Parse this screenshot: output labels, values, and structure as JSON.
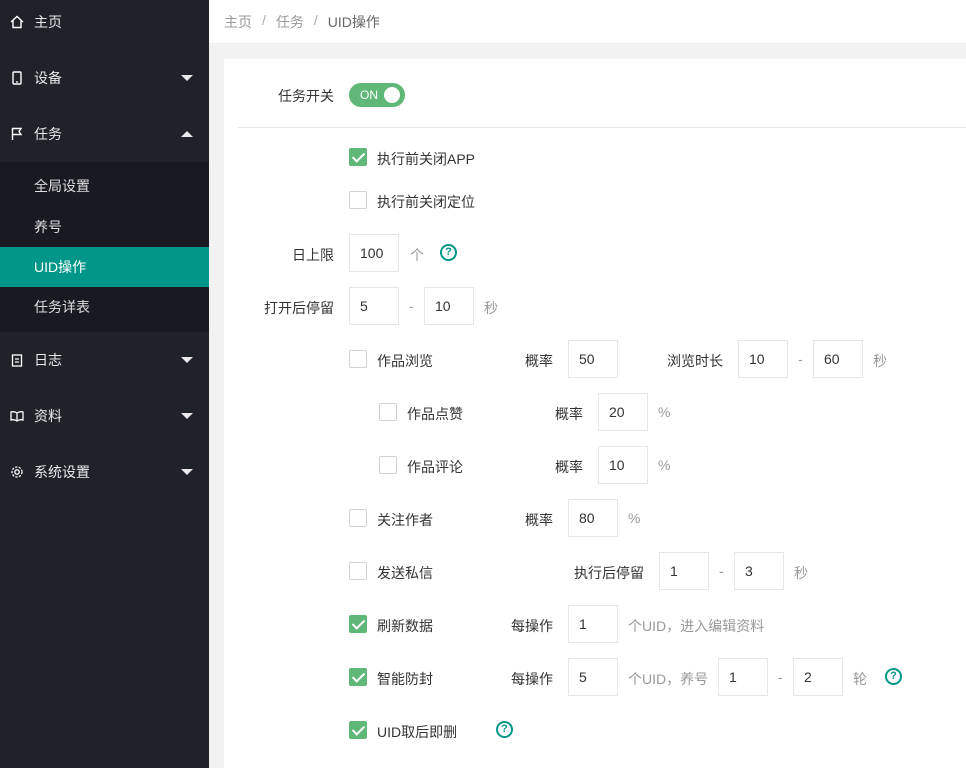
{
  "sidebar": {
    "items": [
      {
        "label": "主页",
        "icon": "home-icon"
      },
      {
        "label": "设备",
        "icon": "phone-icon"
      },
      {
        "label": "任务",
        "icon": "flag-icon"
      },
      {
        "label": "日志",
        "icon": "clipboard-icon"
      },
      {
        "label": "资料",
        "icon": "book-icon"
      },
      {
        "label": "系统设置",
        "icon": "gear-icon"
      }
    ],
    "sub_items": [
      {
        "label": "全局设置"
      },
      {
        "label": "养号"
      },
      {
        "label": "UID操作"
      },
      {
        "label": "任务详表"
      }
    ]
  },
  "breadcrumb": [
    "主页",
    "任务",
    "UID操作"
  ],
  "form": {
    "task_switch_label": "任务开关",
    "toggle_text": "ON",
    "close_app_label": "执行前关闭APP",
    "close_location_label": "执行前关闭定位",
    "daily_limit_label": "日上限",
    "daily_limit_value": "100",
    "daily_limit_unit": "个",
    "stay_label": "打开后停留",
    "stay_min": "5",
    "stay_max": "10",
    "stay_unit": "秒",
    "dash": "-",
    "browse_label": "作品浏览",
    "prob_label": "概率",
    "browse_prob": "50",
    "browse_duration_label": "浏览时长",
    "browse_min": "10",
    "browse_max": "60",
    "like_label": "作品点赞",
    "like_prob": "20",
    "comment_label": "作品评论",
    "comment_prob": "10",
    "percent": "%",
    "follow_label": "关注作者",
    "follow_prob": "80",
    "dm_label": "发送私信",
    "after_stay_label": "执行后停留",
    "dm_min": "1",
    "dm_max": "3",
    "refresh_label": "刷新数据",
    "per_op_label": "每操作",
    "refresh_value": "1",
    "refresh_suffix": "个UID，进入编辑资料",
    "anti_label": "智能防封",
    "anti_value": "5",
    "anti_suffix": "个UID，养号",
    "anti_min": "1",
    "anti_max": "2",
    "anti_unit": "轮",
    "delete_label": "UID取后即删",
    "help_glyph": "?"
  },
  "colors": {
    "accent": "#009688",
    "checkbox_on": "#5fb878",
    "sidebar_bg": "#20222a"
  }
}
